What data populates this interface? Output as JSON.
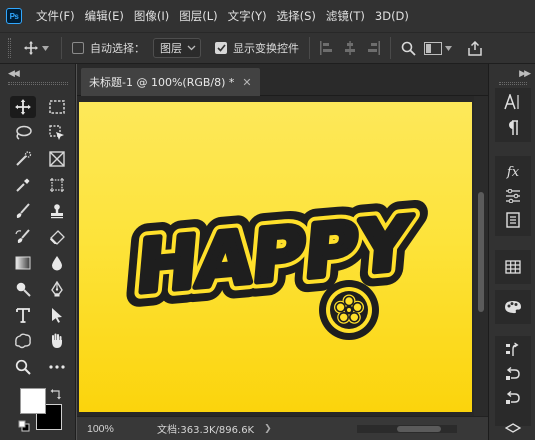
{
  "app": {
    "logo_text": "Ps",
    "menu": [
      "文件(F)",
      "编辑(E)",
      "图像(I)",
      "图层(L)",
      "文字(Y)",
      "选择(S)",
      "滤镜(T)",
      "3D(D)"
    ]
  },
  "options": {
    "auto_select_label": "自动选择：",
    "auto_select_checked": false,
    "auto_select_target": "图层",
    "show_transform_label": "显示变换控件",
    "show_transform_checked": true
  },
  "document": {
    "tab_title": "未标题-1 @ 100%(RGB/8) *",
    "artwork_text": "HAPPY",
    "canvas_colors": {
      "top": "#fde85a",
      "bottom": "#fbd40c",
      "text": "#1e1e1e",
      "outline": "#ffe02a"
    }
  },
  "status": {
    "zoom": "100%",
    "doc_info": "文档:363.3K/896.6K"
  },
  "colors": {
    "foreground": "#ffffff",
    "background": "#000000",
    "ui_dark": "#323232",
    "accent": "#31a8ff"
  },
  "tools": [
    "move-tool",
    "marquee-tool",
    "lasso-tool",
    "object-select-tool",
    "quick-select-tool",
    "frame-tool",
    "eyedropper-tool",
    "crop-tool",
    "healing-brush-tool",
    "stamp-tool",
    "brush-tool",
    "history-brush-tool",
    "eraser-tool",
    "gradient-tool",
    "blur-tool",
    "dodge-tool",
    "pen-tool",
    "type-tool",
    "path-select-tool",
    "shape-tool",
    "hand-tool",
    "zoom-tool",
    "more-tools"
  ],
  "right_panels": [
    "character-panel",
    "paragraph-panel",
    "fx-panel",
    "adjustments-panel",
    "properties-panel",
    "swatches-panel",
    "color-panel",
    "history-panel"
  ]
}
